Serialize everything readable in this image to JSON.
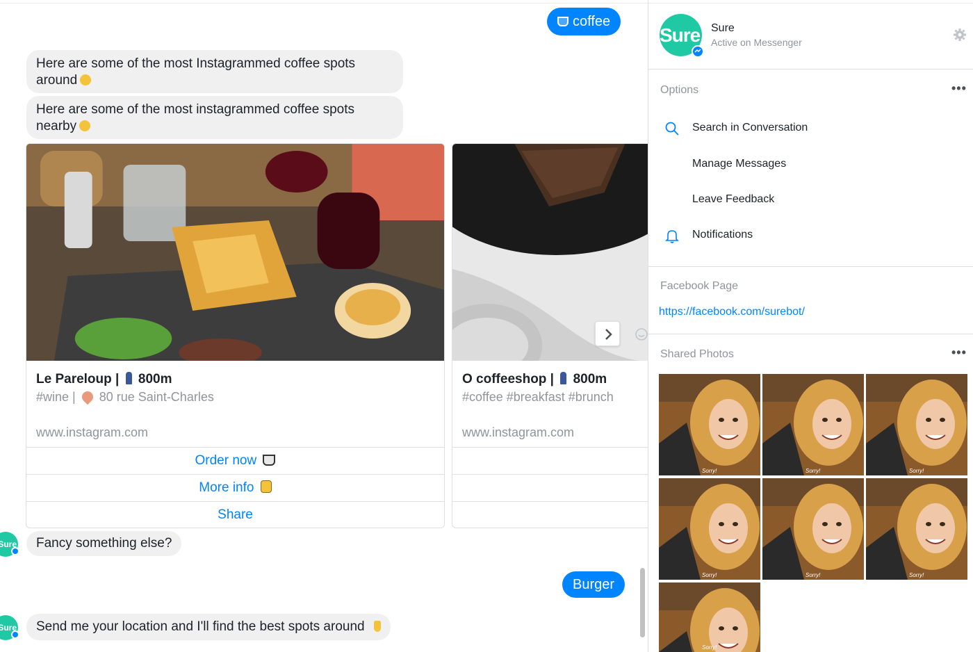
{
  "conversation": {
    "user_message_1": "coffee",
    "bot_message_1": "Here are some of the most Instagrammed coffee spots around",
    "bot_message_2": "Here are some of the most instagrammed coffee spots nearby",
    "bot_message_3": "Fancy something else?",
    "user_message_2": "Burger",
    "bot_message_4": "Send me your location and I'll find the best spots around"
  },
  "cards": [
    {
      "name": "Le Pareloup |",
      "distance": "800m",
      "tags": "#wine |",
      "address": "80 rue Saint-Charles",
      "domain": "www.instagram.com",
      "buttons": [
        "Order now",
        "More info",
        "Share"
      ]
    },
    {
      "name": "O coffeeshop |",
      "distance": "800m",
      "tags": "#coffee #breakfast #brunch",
      "domain": "www.instagram.com"
    }
  ],
  "sidebar": {
    "avatar_text": "Sure.",
    "chat_avatar_text": "Sure",
    "name": "Sure",
    "status": "Active on Messenger",
    "options_label": "Options",
    "options": [
      "Search in Conversation",
      "Manage Messages",
      "Leave Feedback",
      "Notifications"
    ],
    "facebook_page_label": "Facebook Page",
    "facebook_page_url": "https://facebook.com/surebot/",
    "shared_photos_label": "Shared Photos",
    "photo_caption": "Sorry!",
    "more_icon": "•••"
  },
  "colors": {
    "brand_teal": "#1ec9a3",
    "messenger_blue": "#0084ff"
  },
  "icons": [
    "gear-icon",
    "search-icon",
    "bell-icon",
    "chevron-right-icon",
    "smiley-icon",
    "more-dots-icon",
    "person-icon",
    "pin-icon",
    "coffee-cup-icon",
    "thumbs-up-icon"
  ]
}
